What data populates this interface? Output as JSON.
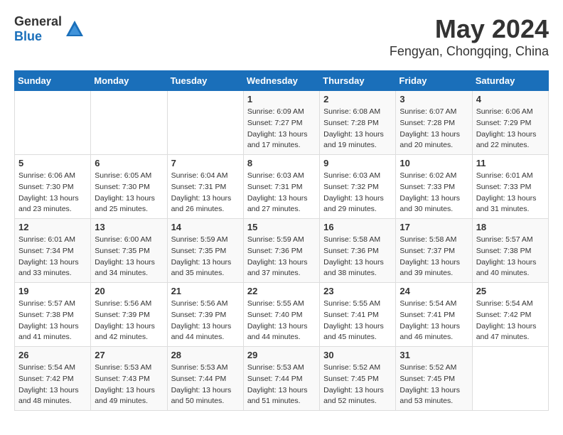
{
  "header": {
    "logo_general": "General",
    "logo_blue": "Blue",
    "main_title": "May 2024",
    "subtitle": "Fengyan, Chongqing, China"
  },
  "calendar": {
    "days_of_week": [
      "Sunday",
      "Monday",
      "Tuesday",
      "Wednesday",
      "Thursday",
      "Friday",
      "Saturday"
    ],
    "weeks": [
      [
        {
          "day": "",
          "info": ""
        },
        {
          "day": "",
          "info": ""
        },
        {
          "day": "",
          "info": ""
        },
        {
          "day": "1",
          "info": "Sunrise: 6:09 AM\nSunset: 7:27 PM\nDaylight: 13 hours\nand 17 minutes."
        },
        {
          "day": "2",
          "info": "Sunrise: 6:08 AM\nSunset: 7:28 PM\nDaylight: 13 hours\nand 19 minutes."
        },
        {
          "day": "3",
          "info": "Sunrise: 6:07 AM\nSunset: 7:28 PM\nDaylight: 13 hours\nand 20 minutes."
        },
        {
          "day": "4",
          "info": "Sunrise: 6:06 AM\nSunset: 7:29 PM\nDaylight: 13 hours\nand 22 minutes."
        }
      ],
      [
        {
          "day": "5",
          "info": "Sunrise: 6:06 AM\nSunset: 7:30 PM\nDaylight: 13 hours\nand 23 minutes."
        },
        {
          "day": "6",
          "info": "Sunrise: 6:05 AM\nSunset: 7:30 PM\nDaylight: 13 hours\nand 25 minutes."
        },
        {
          "day": "7",
          "info": "Sunrise: 6:04 AM\nSunset: 7:31 PM\nDaylight: 13 hours\nand 26 minutes."
        },
        {
          "day": "8",
          "info": "Sunrise: 6:03 AM\nSunset: 7:31 PM\nDaylight: 13 hours\nand 27 minutes."
        },
        {
          "day": "9",
          "info": "Sunrise: 6:03 AM\nSunset: 7:32 PM\nDaylight: 13 hours\nand 29 minutes."
        },
        {
          "day": "10",
          "info": "Sunrise: 6:02 AM\nSunset: 7:33 PM\nDaylight: 13 hours\nand 30 minutes."
        },
        {
          "day": "11",
          "info": "Sunrise: 6:01 AM\nSunset: 7:33 PM\nDaylight: 13 hours\nand 31 minutes."
        }
      ],
      [
        {
          "day": "12",
          "info": "Sunrise: 6:01 AM\nSunset: 7:34 PM\nDaylight: 13 hours\nand 33 minutes."
        },
        {
          "day": "13",
          "info": "Sunrise: 6:00 AM\nSunset: 7:35 PM\nDaylight: 13 hours\nand 34 minutes."
        },
        {
          "day": "14",
          "info": "Sunrise: 5:59 AM\nSunset: 7:35 PM\nDaylight: 13 hours\nand 35 minutes."
        },
        {
          "day": "15",
          "info": "Sunrise: 5:59 AM\nSunset: 7:36 PM\nDaylight: 13 hours\nand 37 minutes."
        },
        {
          "day": "16",
          "info": "Sunrise: 5:58 AM\nSunset: 7:36 PM\nDaylight: 13 hours\nand 38 minutes."
        },
        {
          "day": "17",
          "info": "Sunrise: 5:58 AM\nSunset: 7:37 PM\nDaylight: 13 hours\nand 39 minutes."
        },
        {
          "day": "18",
          "info": "Sunrise: 5:57 AM\nSunset: 7:38 PM\nDaylight: 13 hours\nand 40 minutes."
        }
      ],
      [
        {
          "day": "19",
          "info": "Sunrise: 5:57 AM\nSunset: 7:38 PM\nDaylight: 13 hours\nand 41 minutes."
        },
        {
          "day": "20",
          "info": "Sunrise: 5:56 AM\nSunset: 7:39 PM\nDaylight: 13 hours\nand 42 minutes."
        },
        {
          "day": "21",
          "info": "Sunrise: 5:56 AM\nSunset: 7:39 PM\nDaylight: 13 hours\nand 44 minutes."
        },
        {
          "day": "22",
          "info": "Sunrise: 5:55 AM\nSunset: 7:40 PM\nDaylight: 13 hours\nand 44 minutes."
        },
        {
          "day": "23",
          "info": "Sunrise: 5:55 AM\nSunset: 7:41 PM\nDaylight: 13 hours\nand 45 minutes."
        },
        {
          "day": "24",
          "info": "Sunrise: 5:54 AM\nSunset: 7:41 PM\nDaylight: 13 hours\nand 46 minutes."
        },
        {
          "day": "25",
          "info": "Sunrise: 5:54 AM\nSunset: 7:42 PM\nDaylight: 13 hours\nand 47 minutes."
        }
      ],
      [
        {
          "day": "26",
          "info": "Sunrise: 5:54 AM\nSunset: 7:42 PM\nDaylight: 13 hours\nand 48 minutes."
        },
        {
          "day": "27",
          "info": "Sunrise: 5:53 AM\nSunset: 7:43 PM\nDaylight: 13 hours\nand 49 minutes."
        },
        {
          "day": "28",
          "info": "Sunrise: 5:53 AM\nSunset: 7:44 PM\nDaylight: 13 hours\nand 50 minutes."
        },
        {
          "day": "29",
          "info": "Sunrise: 5:53 AM\nSunset: 7:44 PM\nDaylight: 13 hours\nand 51 minutes."
        },
        {
          "day": "30",
          "info": "Sunrise: 5:52 AM\nSunset: 7:45 PM\nDaylight: 13 hours\nand 52 minutes."
        },
        {
          "day": "31",
          "info": "Sunrise: 5:52 AM\nSunset: 7:45 PM\nDaylight: 13 hours\nand 53 minutes."
        },
        {
          "day": "",
          "info": ""
        }
      ]
    ]
  }
}
